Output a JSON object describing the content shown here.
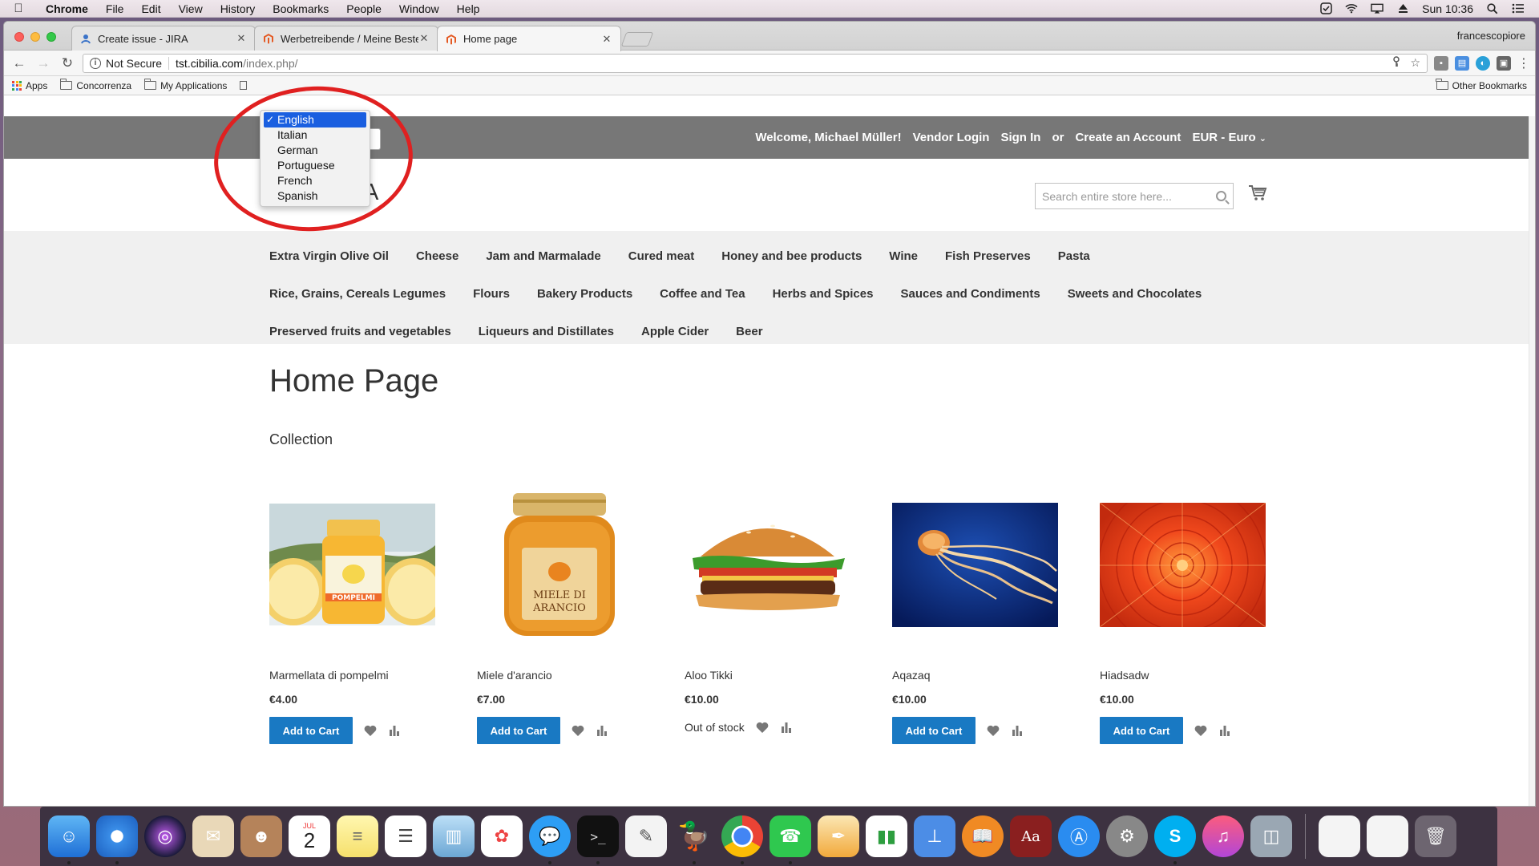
{
  "menubar": {
    "app_name": "Chrome",
    "items": [
      "File",
      "Edit",
      "View",
      "History",
      "Bookmarks",
      "People",
      "Window",
      "Help"
    ],
    "clock": "Sun 10:36"
  },
  "browser": {
    "tabs": [
      {
        "label": "Create issue - JIRA",
        "favicon_color": "#3b73c8"
      },
      {
        "label": "Werbetreibende / Meine Beste",
        "favicon_color": "#e45a24"
      },
      {
        "label": "Home page",
        "favicon_color": "#e45a24"
      }
    ],
    "profile_name": "francescopiore",
    "address": {
      "security": "Not Secure",
      "host": "tst.cibilia.com",
      "path": "/index.php/"
    },
    "bookmarks": [
      "Apps",
      "Concorrenza",
      "My Applications"
    ],
    "other_bookmarks": "Other Bookmarks"
  },
  "store": {
    "welcome": "Welcome, Michael Müller!",
    "vendor_login": "Vendor Login",
    "sign_in": "Sign In",
    "or": "or",
    "create_account": "Create an Account",
    "currency": "EUR - Euro",
    "logo_visible": "A",
    "search_placeholder": "Search entire store here...",
    "language_options": [
      "English",
      "Italian",
      "German",
      "Portuguese",
      "French",
      "Spanish"
    ],
    "language_selected": "English",
    "nav_rows": [
      [
        "Extra Virgin Olive Oil",
        "Cheese",
        "Jam and Marmalade",
        "Cured meat",
        "Honey and bee products",
        "Wine",
        "Fish Preserves",
        "Pasta"
      ],
      [
        "Rice, Grains, Cereals Legumes",
        "Flours",
        "Bakery Products",
        "Coffee and Tea",
        "Herbs and Spices",
        "Sauces and Condiments",
        "Sweets and Chocolates"
      ],
      [
        "Preserved fruits and vegetables",
        "Liqueurs and Distillates",
        "Apple Cider",
        "Beer"
      ]
    ],
    "page_title": "Home Page",
    "collection_heading": "Collection",
    "add_to_cart": "Add to Cart",
    "products": [
      {
        "name": "Marmellata di pompelmi",
        "price": "€4.00",
        "stock": "in",
        "label_text": "POMPELMI"
      },
      {
        "name": "Miele d'arancio",
        "price": "€7.00",
        "stock": "in",
        "label_text": "MIELE DI ARANCIO"
      },
      {
        "name": "Aloo Tikki",
        "price": "€10.00",
        "stock": "out",
        "stock_text": "Out of stock"
      },
      {
        "name": "Aqazaq",
        "price": "€10.00",
        "stock": "in"
      },
      {
        "name": "Hiadsadw",
        "price": "€10.00",
        "stock": "in"
      }
    ]
  },
  "colors": {
    "accent_blue": "#1979c3",
    "annotation_red": "#e02020",
    "topbar_gray": "#777777"
  },
  "dock_apps": [
    "finder",
    "safari",
    "siri",
    "mail-app",
    "contacts",
    "calendar",
    "notes",
    "reminders",
    "preview",
    "photos",
    "messages",
    "terminal",
    "textedit",
    "cyberduck",
    "chrome",
    "facetime",
    "pages",
    "numbers",
    "keynote",
    "ibooks",
    "dictionary",
    "app-store",
    "system-preferences",
    "skype",
    "itunes",
    "image-capture"
  ],
  "calendar_day": "2",
  "calendar_month": "JUL"
}
